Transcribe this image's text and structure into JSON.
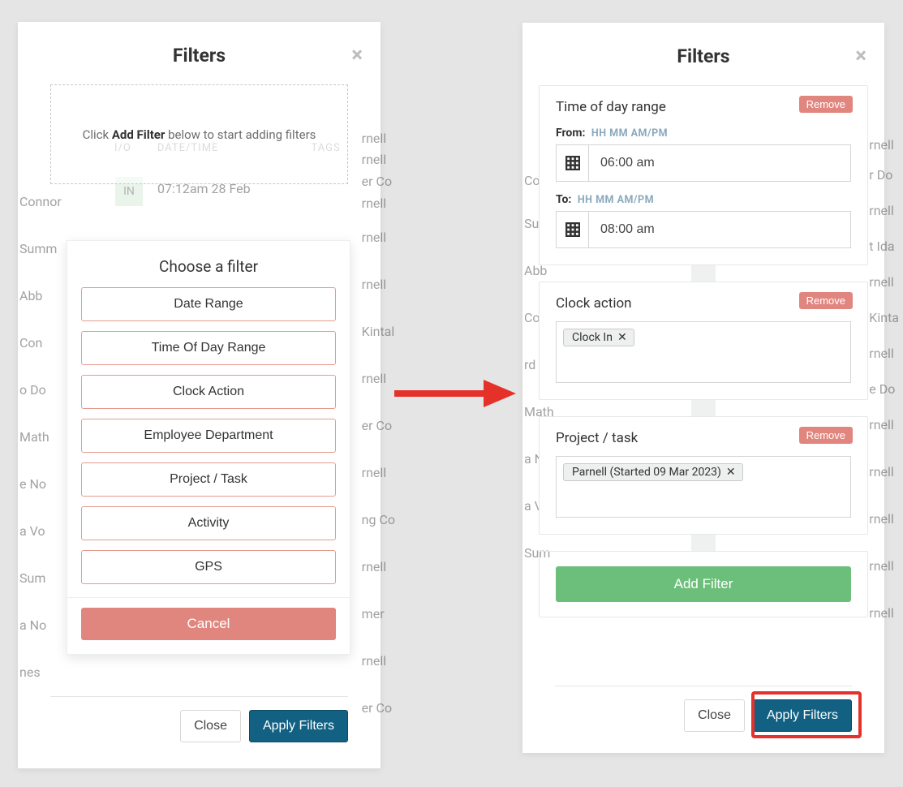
{
  "left": {
    "title": "Filters",
    "hint_pre": "Click ",
    "hint_bold": "Add Filter",
    "hint_post": " below to start adding filters",
    "chooser_title": "Choose a filter",
    "options": {
      "date_range": "Date Range",
      "time_of_day": "Time Of Day Range",
      "clock_action": "Clock Action",
      "employee_dept": "Employee Department",
      "project_task": "Project / Task",
      "activity": "Activity",
      "gps": "GPS"
    },
    "cancel": "Cancel",
    "close": "Close",
    "apply": "Apply Filters",
    "ghost": {
      "header_io": "I/O",
      "header_dt": "DATE/TIME",
      "header_tags": "TAGS",
      "pill": "IN",
      "dt": "07:12am 28 Feb",
      "names": [
        "Connor",
        "Summ",
        "Abb",
        "Con",
        "o Do",
        "Math",
        "e No",
        "a Vo",
        "Sum",
        "a No",
        "nes"
      ],
      "right": [
        "rnell",
        "rnell",
        "er Co",
        "rnell",
        "rnell",
        "rnell",
        "Kintal",
        "rnell",
        "er Co",
        "rnell",
        "ng Co",
        "rnell",
        "mer",
        "rnell",
        "er Co"
      ]
    }
  },
  "right": {
    "title": "Filters",
    "time_panel": {
      "title": "Time of day range",
      "from_label": "From:",
      "to_label": "To:",
      "hint": "HH MM AM/PM",
      "from_value": "06:00 am",
      "to_value": "08:00 am"
    },
    "clock_panel": {
      "title": "Clock action",
      "tag": "Clock In"
    },
    "project_panel": {
      "title": "Project / task",
      "tag": "Parnell (Started 09 Mar 2023)"
    },
    "remove": "Remove",
    "add_filter": "Add Filter",
    "close": "Close",
    "apply": "Apply Filters",
    "ghost": {
      "names": [
        "Con",
        "Sum",
        "Abb",
        "Con",
        "rd Do",
        "Math",
        "a No",
        "a Vo",
        "Sum"
      ],
      "right": [
        "rnell",
        "r Do",
        "rnell",
        "t Ida",
        "rnell",
        "Kinta",
        "rnell",
        "e Do",
        "rnell",
        "rnell",
        "rnell",
        "rnell",
        "rnell"
      ]
    }
  }
}
